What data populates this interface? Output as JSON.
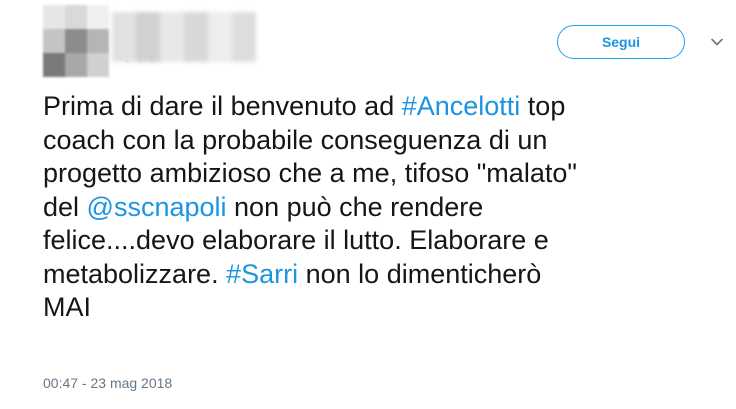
{
  "tweet": {
    "follow_label": "Segui",
    "text_segments": {
      "l1a": "Prima di dare il benvenuto ad ",
      "h1": "#Ancelotti",
      "l1b": " top",
      "l2": "coach con la probabile conseguenza di un",
      "l3": "progetto ambizioso che a me, tifoso \"malato\"",
      "l4a": "del ",
      "m1": "@sscnapoli",
      "l4b": " non può che rendere",
      "l5": "felice....devo elaborare il lutto. Elaborare e",
      "l6a": "metabolizzare. ",
      "h2": "#Sarri",
      "l6b": " non lo dimenticherò",
      "l7": "MAI"
    },
    "timestamp": "00:47 - 23 mag 2018",
    "colors": {
      "link": "#1b95e0",
      "text": "#14171a",
      "muted": "#657786"
    },
    "icons": {
      "menu": "chevron-down-icon"
    }
  }
}
